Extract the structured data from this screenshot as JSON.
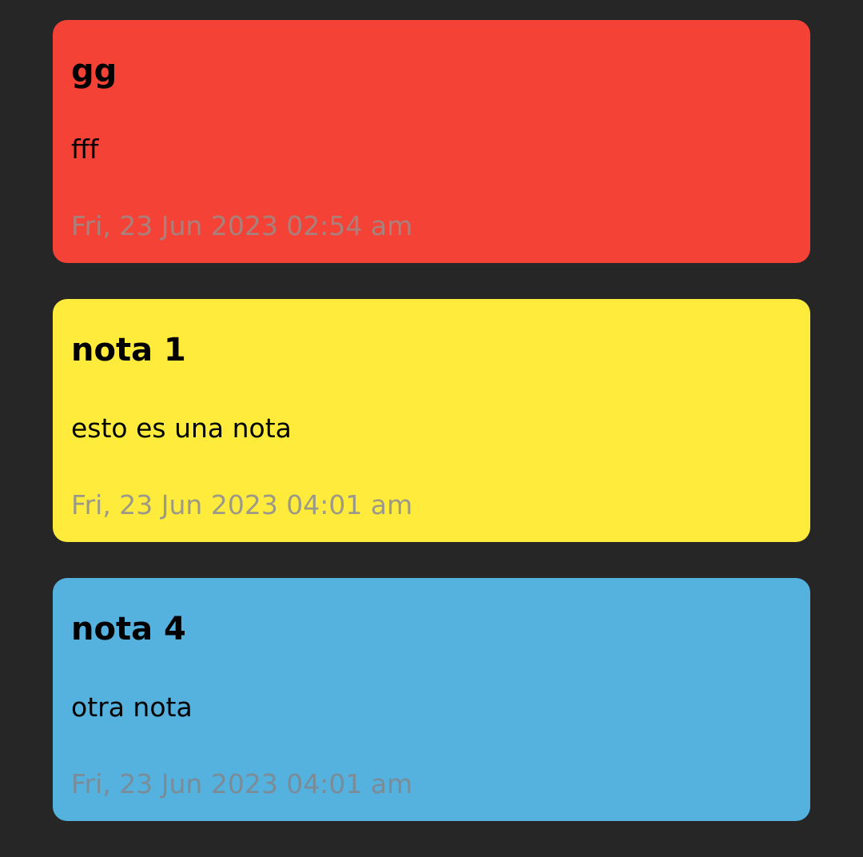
{
  "notes": [
    {
      "title": "gg",
      "body": "fff",
      "date": "Fri, 23 Jun 2023 02:54 am",
      "color": "#f44336",
      "date_color": "#a8807c"
    },
    {
      "title": "nota 1",
      "body": "esto es una nota",
      "date": "Fri, 23 Jun 2023 04:01 am",
      "color": "#ffeb3b",
      "date_color": "#9c9a86"
    },
    {
      "title": "nota 4",
      "body": "otra nota",
      "date": "Fri, 23 Jun 2023 04:01 am",
      "color": "#55b1dd",
      "date_color": "#7a8c98"
    }
  ],
  "colors": {
    "background": "#262626"
  }
}
